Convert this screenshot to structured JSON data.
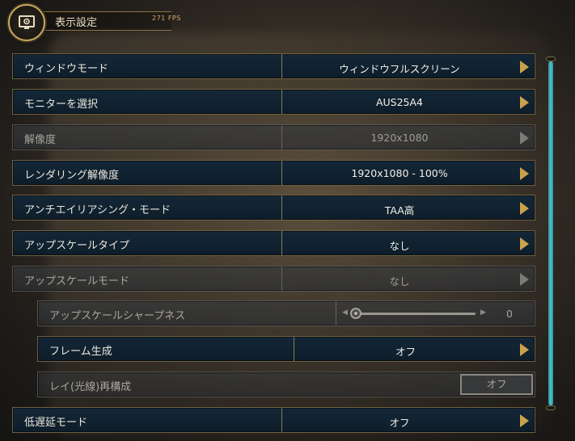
{
  "header": {
    "title": "表示設定",
    "fps": "271 FPS"
  },
  "rows": [
    {
      "label": "ウィンドウモード",
      "value": "ウィンドウフルスクリーン"
    },
    {
      "label": "モニターを選択",
      "value": "AUS25A4"
    },
    {
      "label": "解像度",
      "value": "1920x1080"
    },
    {
      "label": "レンダリング解像度",
      "value": "1920x1080 - 100%"
    },
    {
      "label": "アンチエイリアシング・モード",
      "value": "TAA高"
    },
    {
      "label": "アップスケールタイプ",
      "value": "なし"
    },
    {
      "label": "アップスケールモード",
      "value": "なし"
    },
    {
      "label": "アップスケールシャープネス",
      "value": "0",
      "slider_level": 0
    },
    {
      "label": "フレーム生成",
      "value": "オフ"
    },
    {
      "label": "レイ(光線)再構成",
      "value": "オフ"
    },
    {
      "label": "低遅延モード",
      "value": "オフ"
    }
  ],
  "colors": {
    "accent_gold": "#c9a95a",
    "row_bg": "#142737",
    "scroll_teal": "#4ec4cc"
  },
  "icons": {
    "header": "monitor-gear-icon",
    "next": "chevron-right-icon"
  }
}
